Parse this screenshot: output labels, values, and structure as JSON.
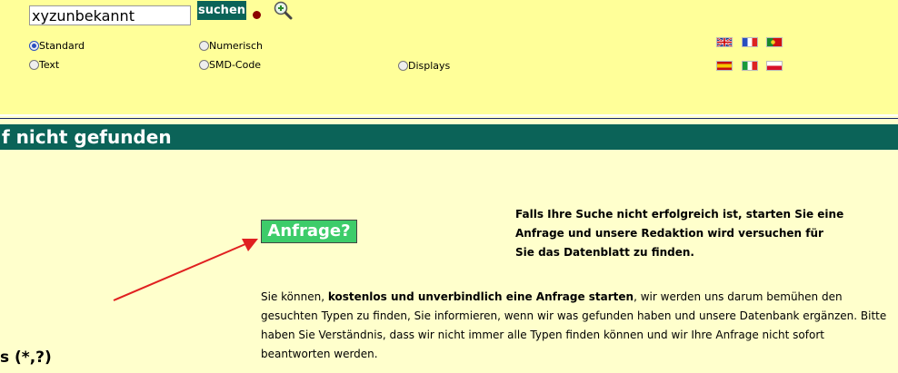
{
  "search": {
    "value": "xyzunbekannt",
    "button_label": "suchen"
  },
  "radios": [
    {
      "label": "Standard",
      "checked": true
    },
    {
      "label": "Numerisch",
      "checked": false
    },
    {
      "label": "Text",
      "checked": false
    },
    {
      "label": "SMD-Code",
      "checked": false
    },
    {
      "label": "Displays",
      "checked": false
    }
  ],
  "flags": [
    "english-flag-icon",
    "french-flag-icon",
    "portuguese-flag-icon",
    "spanish-flag-icon",
    "italian-flag-icon",
    "polish-flag-icon"
  ],
  "title": "f nicht gefunden",
  "anfrage_label": "Anfrage?",
  "bold_message": [
    "Falls Ihre Suche nicht erfolgreich ist, starten Sie eine",
    "Anfrage und unsere Redaktion wird versuchen für",
    "Sie das Datenblatt zu finden."
  ],
  "info": {
    "part1": "Sie können, ",
    "bold": "kostenlos und unverbindlich eine Anfrage starten",
    "part2": ", wir werden uns darum bemühen den gesuchten Typen zu finden, Sie informieren, wenn wir was gefunden haben  und unsere Datenbank ergänzen. Bitte haben Sie Verständnis, dass wir nicht immer alle Typen finden können und wir Ihre Anfrage nicht sofort beantworten werden."
  },
  "side_text": "s (*,?)",
  "colors": {
    "header_bg": "#ffff99",
    "page_bg": "#ffffcc",
    "teal": "#0b6358",
    "anfrage_green": "#3dcc6a",
    "arrow": "#e02020"
  }
}
